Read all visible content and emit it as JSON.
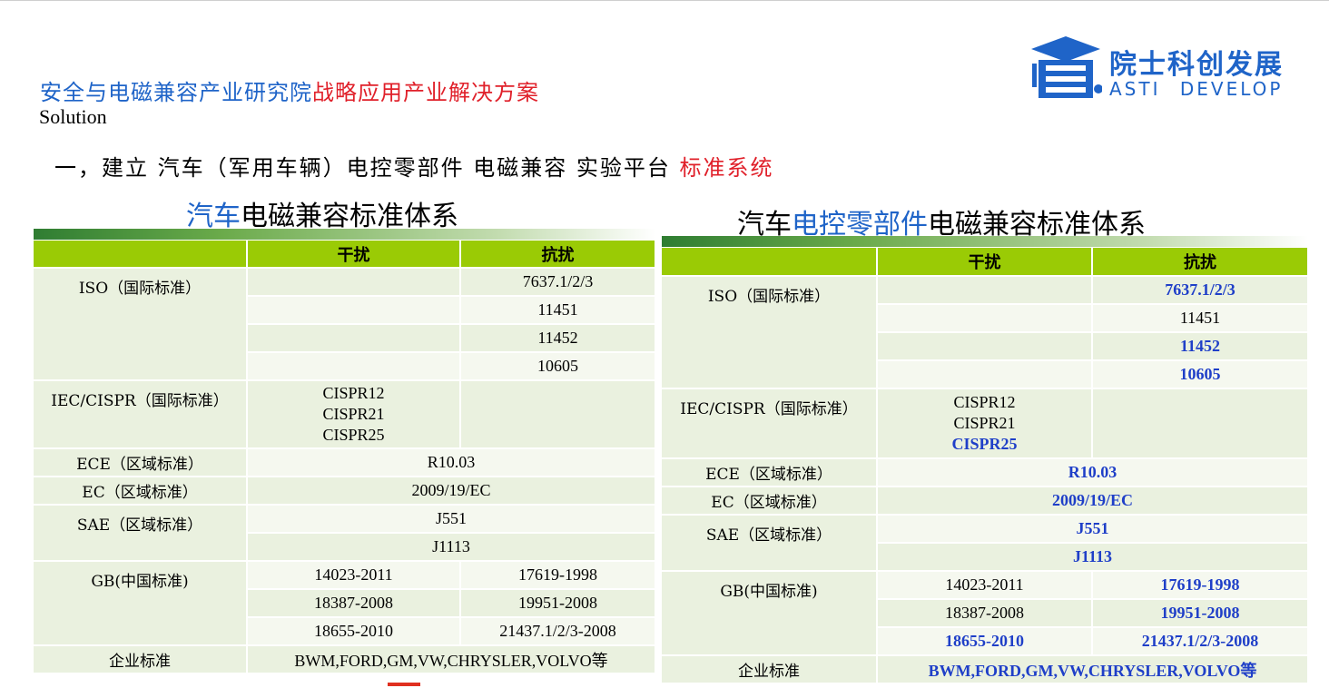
{
  "header": {
    "line_blue": "安全与电磁兼容产业研究院",
    "line_red": "战略应用产业解决方案",
    "solution": "Solution"
  },
  "section": {
    "title_black": "一，建立 汽车（军用车辆）电控零部件 电磁兼容 实验平台",
    "title_red": "标准系统"
  },
  "logo": {
    "cn": "院士科创发展",
    "en": "ASTI DEVELOP",
    "icon": "graduation-cap-building-icon",
    "color": "#1f64c8"
  },
  "colors": {
    "blue_text": "#1f64c8",
    "red_text": "#e0202a",
    "table_header": "#9acb05",
    "row_light": "#eaf1df",
    "bold_blue": "#1f3fc8"
  },
  "table1": {
    "title_blue": "汽车",
    "title_black": "电磁兼容标准体系",
    "col_interference": "干扰",
    "col_immunity": "抗扰",
    "iso": {
      "label": "ISO（国际标准）",
      "immunity": [
        "7637.1/2/3",
        "11451",
        "11452",
        "10605"
      ]
    },
    "iec": {
      "label": "IEC/CISPR（国际标准）",
      "interference": [
        "CISPR12",
        "CISPR21",
        "CISPR25"
      ]
    },
    "ece": {
      "label": "ECE（区域标准）",
      "value": "R10.03"
    },
    "ec": {
      "label": "EC（区域标准）",
      "value": "2009/19/EC"
    },
    "sae": {
      "label": "SAE（区域标准）",
      "values": [
        "J551",
        "J1113"
      ]
    },
    "gb": {
      "label": "GB(中国标准)",
      "interference": [
        "14023-2011",
        "18387-2008",
        "18655-2010"
      ],
      "immunity": [
        "17619-1998",
        "19951-2008",
        "21437.1/2/3-2008"
      ]
    },
    "corp": {
      "label": "企业标准",
      "value": "BWM,FORD,GM,VW,CHRYSLER,VOLVO等"
    }
  },
  "table2": {
    "title_black1": "汽车",
    "title_blue": "电控零部件",
    "title_black2": "电磁兼容标准体系",
    "col_interference": "干扰",
    "col_immunity": "抗扰",
    "iso": {
      "label": "ISO（国际标准）",
      "immunity": [
        "7637.1/2/3",
        "11451",
        "11452",
        "10605"
      ]
    },
    "iec": {
      "label": "IEC/CISPR（国际标准）",
      "interference": [
        "CISPR12",
        "CISPR21",
        "CISPR25"
      ]
    },
    "ece": {
      "label": "ECE（区域标准）",
      "value": "R10.03"
    },
    "ec": {
      "label": "EC（区域标准）",
      "value": "2009/19/EC"
    },
    "sae": {
      "label": "SAE（区域标准）",
      "values": [
        "J551",
        "J1113"
      ]
    },
    "gb": {
      "label": "GB(中国标准)",
      "interference": [
        "14023-2011",
        "18387-2008",
        "18655-2010"
      ],
      "immunity": [
        "17619-1998",
        "19951-2008",
        "21437.1/2/3-2008"
      ]
    },
    "corp": {
      "label": "企业标准",
      "value": "BWM,FORD,GM,VW,CHRYSLER,VOLVO等"
    }
  }
}
